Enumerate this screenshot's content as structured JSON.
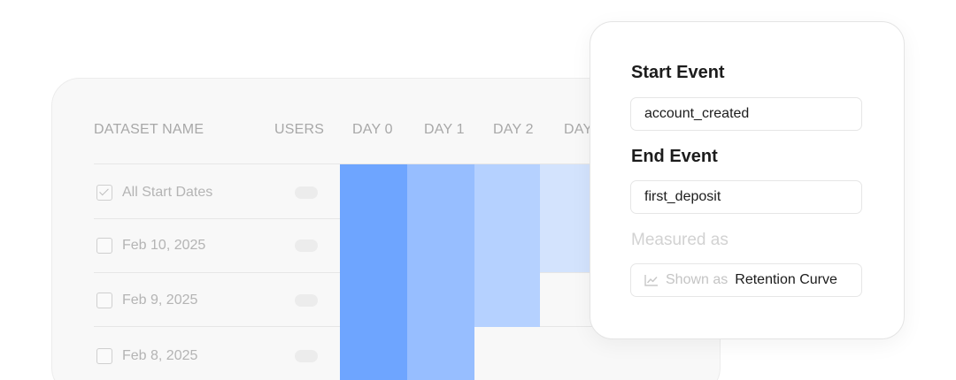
{
  "table": {
    "columns": [
      "DATASET NAME",
      "USERS",
      "DAY 0",
      "DAY 1",
      "DAY 2",
      "DAY"
    ],
    "rows": [
      {
        "label": "All Start Dates",
        "checked": true
      },
      {
        "label": "Feb 10, 2025",
        "checked": false
      },
      {
        "label": "Feb 9, 2025",
        "checked": false
      },
      {
        "label": "Feb 8, 2025",
        "checked": false
      }
    ],
    "heat_colors": [
      "#6ea5ff",
      "#97beff",
      "#b5d1ff",
      "#d3e3fd"
    ]
  },
  "popover": {
    "start_event_label": "Start Event",
    "start_event_value": "account_created",
    "end_event_label": "End Event",
    "end_event_value": "first_deposit",
    "measured_as_label": "Measured as",
    "shown_as_prefix": "Shown as",
    "shown_as_value": "Retention Curve",
    "shown_as_icon": "line-chart-icon"
  }
}
